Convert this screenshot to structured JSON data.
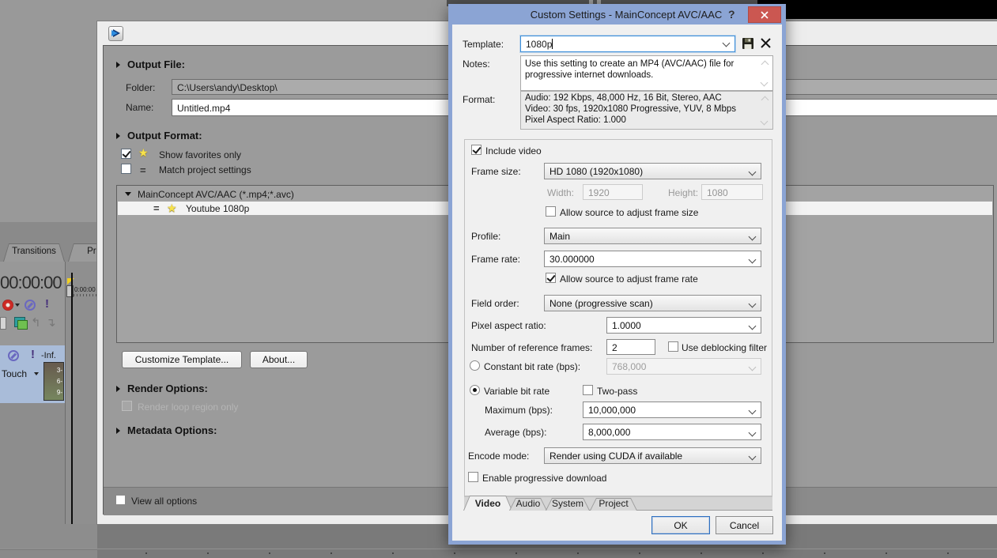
{
  "colors": {
    "accent_blue": "#8ba4d4",
    "close_red": "#cb5751",
    "star_yellow": "#f7e24b",
    "selection_highlight": "#f3f3f3"
  },
  "vegas": {
    "tabs": [
      "Transitions",
      "Project"
    ],
    "time_display": "00:00:00",
    "ruler_label": "0:00:00",
    "track_panel": {
      "inf_label": "-Inf.",
      "touch_label": "Touch",
      "meter_marks": [
        "3-",
        "6-",
        "9-"
      ]
    }
  },
  "render_window": {
    "output_file": {
      "heading": "Output File:",
      "folder_label": "Folder:",
      "folder_value": "C:\\Users\\andy\\Desktop\\",
      "name_label": "Name:",
      "name_value": "Untitled.mp4"
    },
    "output_format": {
      "heading": "Output Format:",
      "show_favorites": "Show favorites only",
      "match_project": "Match project settings",
      "list_parent": "MainConcept AVC/AAC (*.mp4;*.avc)",
      "list_selected": "Youtube 1080p"
    },
    "buttons": {
      "customize": "Customize Template...",
      "about": "About..."
    },
    "render_options": {
      "heading": "Render Options:",
      "loop_label": "Render loop region only"
    },
    "metadata_options": {
      "heading": "Metadata Options:"
    },
    "view_all_label": "View all options"
  },
  "dialog": {
    "title": "Custom Settings - MainConcept AVC/AAC",
    "help_label": "?",
    "template_label": "Template:",
    "template_value": "1080p",
    "notes_label": "Notes:",
    "notes_text": "Use this setting to create an MP4 (AVC/AAC) file for progressive internet downloads.",
    "format_label": "Format:",
    "format_lines": [
      "Audio: 192 Kbps, 48,000 Hz, 16 Bit, Stereo, AAC",
      "Video: 30 fps, 1920x1080 Progressive, YUV, 8 Mbps",
      "Pixel Aspect Ratio: 1.000"
    ],
    "video_tab": {
      "include_video": "Include video",
      "frame_size_label": "Frame size:",
      "frame_size_value": "HD 1080 (1920x1080)",
      "width_label": "Width:",
      "width_value": "1920",
      "height_label": "Height:",
      "height_value": "1080",
      "allow_frame_size": "Allow source to adjust frame size",
      "profile_label": "Profile:",
      "profile_value": "Main",
      "frame_rate_label": "Frame rate:",
      "frame_rate_value": "30.000000",
      "allow_frame_rate": "Allow source to adjust frame rate",
      "field_order_label": "Field order:",
      "field_order_value": "None (progressive scan)",
      "pixel_aspect_label": "Pixel aspect ratio:",
      "pixel_aspect_value": "1.0000",
      "ref_frames_label": "Number of reference frames:",
      "ref_frames_value": "2",
      "deblocking_label": "Use deblocking filter",
      "cbr_label": "Constant bit rate (bps):",
      "cbr_value": "768,000",
      "vbr_label": "Variable bit rate",
      "two_pass_label": "Two-pass",
      "max_label": "Maximum (bps):",
      "max_value": "10,000,000",
      "avg_label": "Average (bps):",
      "avg_value": "8,000,000",
      "encode_label": "Encode mode:",
      "encode_value": "Render using CUDA if available",
      "progressive_label": "Enable progressive download"
    },
    "tabs": [
      "Video",
      "Audio",
      "System",
      "Project"
    ],
    "ok_label": "OK",
    "cancel_label": "Cancel"
  }
}
